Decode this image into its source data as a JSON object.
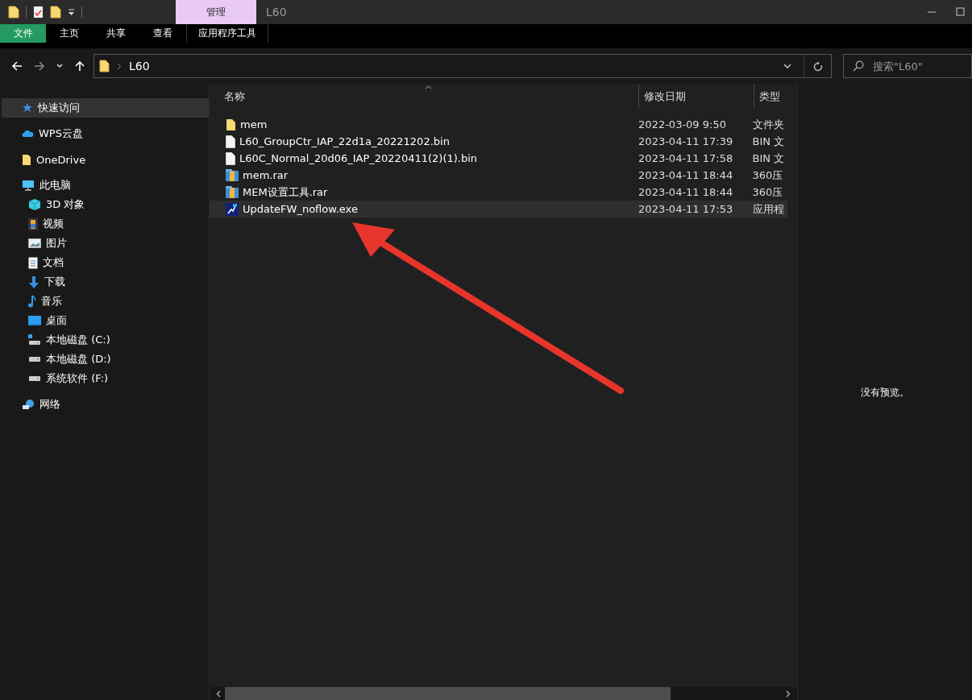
{
  "title_bar": {
    "context_tab": "管理",
    "title": "L60"
  },
  "ribbon_tabs": [
    {
      "label": "文件",
      "selected": true
    },
    {
      "label": "主页",
      "selected": false
    },
    {
      "label": "共享",
      "selected": false
    },
    {
      "label": "查看",
      "selected": false
    },
    {
      "label": "应用程序工具",
      "selected": false
    }
  ],
  "address_bar": {
    "path": "L60"
  },
  "search": {
    "placeholder": "搜索\"L60\""
  },
  "sidebar": {
    "items": [
      {
        "label": "快速访问",
        "kind": "star",
        "selected": true
      },
      {
        "label": "WPS云盘",
        "kind": "cloud",
        "selected": false
      },
      {
        "label": "OneDrive",
        "kind": "folder",
        "selected": false
      },
      {
        "label": "此电脑",
        "kind": "pc",
        "selected": false,
        "children": [
          {
            "label": "3D 对象",
            "kind": "cube",
            "selected": false
          },
          {
            "label": "视频",
            "kind": "film",
            "selected": false
          },
          {
            "label": "图片",
            "kind": "picture",
            "selected": false
          },
          {
            "label": "文档",
            "kind": "doc",
            "selected": false
          },
          {
            "label": "下载",
            "kind": "download",
            "selected": false
          },
          {
            "label": "音乐",
            "kind": "music",
            "selected": false
          },
          {
            "label": "桌面",
            "kind": "desktop",
            "selected": false
          },
          {
            "label": "本地磁盘 (C:)",
            "kind": "sysdrive",
            "selected": false
          },
          {
            "label": "本地磁盘 (D:)",
            "kind": "drive",
            "selected": false
          },
          {
            "label": "系统软件 (F:)",
            "kind": "drive",
            "selected": false
          }
        ]
      },
      {
        "label": "网络",
        "kind": "network",
        "selected": false
      }
    ]
  },
  "table": {
    "columns": [
      "名称",
      "修改日期",
      "类型"
    ],
    "rows": [
      {
        "kind": "folder",
        "name": "mem",
        "date": "2022-03-09 9:50",
        "type": "文件夹",
        "selected": false
      },
      {
        "kind": "file",
        "name": "L60_GroupCtr_IAP_22d1a_20221202.bin",
        "date": "2023-04-11 17:39",
        "type": "BIN 文",
        "selected": false
      },
      {
        "kind": "file",
        "name": "L60C_Normal_20d06_IAP_20220411(2)(1).bin",
        "date": "2023-04-11 17:58",
        "type": "BIN 文",
        "selected": false
      },
      {
        "kind": "archive",
        "name": "mem.rar",
        "date": "2023-04-11 18:44",
        "type": "360压",
        "selected": false
      },
      {
        "kind": "archive",
        "name": "MEM设置工具.rar",
        "date": "2023-04-11 18:44",
        "type": "360压",
        "selected": false
      },
      {
        "kind": "exe",
        "name": "UpdateFW_noflow.exe",
        "date": "2023-04-11 17:53",
        "type": "应用程",
        "selected": true
      }
    ]
  },
  "preview": {
    "message": "没有预览。"
  }
}
